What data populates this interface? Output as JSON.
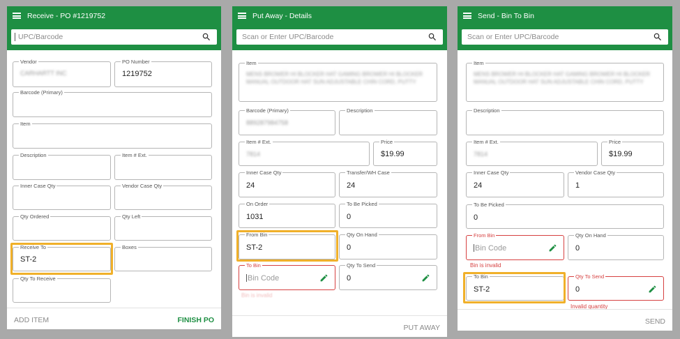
{
  "colors": {
    "brand_green": "#1e8f43",
    "error_red": "#d64040",
    "highlight_orange": "#f0b02a",
    "backdrop": "#a9a9a9"
  },
  "icons": {
    "menu": "hamburger-menu-icon",
    "search": "search-icon",
    "edit": "pencil-icon"
  },
  "receive": {
    "title": "Receive - PO #1219752",
    "search_placeholder": "UPC/Barcode",
    "fields": {
      "vendor": {
        "label": "Vendor",
        "value": "CARHARTT INC"
      },
      "po_number": {
        "label": "PO Number",
        "value": "1219752"
      },
      "barcode": {
        "label": "Barcode (Primary)"
      },
      "item": {
        "label": "Item"
      },
      "description": {
        "label": "Description"
      },
      "item_ext": {
        "label": "Item # Ext."
      },
      "inner_case_qty": {
        "label": "Inner Case Qty"
      },
      "vendor_case_qty": {
        "label": "Vendor Case Qty"
      },
      "qty_ordered": {
        "label": "Qty Ordered"
      },
      "qty_left": {
        "label": "Qty Left"
      },
      "receive_to": {
        "label": "Receive To",
        "value": "ST-2"
      },
      "boxes": {
        "label": "Boxes"
      },
      "qty_to_receive": {
        "label": "Qty To Receive"
      }
    },
    "add_item": "ADD ITEM",
    "finish_po": "FINISH PO"
  },
  "putaway": {
    "title": "Put Away - Details",
    "search_placeholder": "Scan or Enter UPC/Barcode",
    "fields": {
      "item": {
        "label": "Item",
        "value": "MENS BROWER HI BLOCKER HAT GAMING BROWER HI BLOCKER MANUAL OUTDOOR HAT SUN ADJUSTABLE CHIN CORD, PUTTY"
      },
      "barcode": {
        "label": "Barcode (Primary)",
        "value": "889287984758"
      },
      "description": {
        "label": "Description"
      },
      "item_ext": {
        "label": "Item # Ext.",
        "value": "7814"
      },
      "price": {
        "label": "Price",
        "value": "$19.99"
      },
      "inner_case_qty": {
        "label": "Inner Case Qty",
        "value": "24"
      },
      "transfer_case": {
        "label": "Transfer/WH Case",
        "value": "24"
      },
      "on_order": {
        "label": "On Order",
        "value": "1031"
      },
      "to_be_picked": {
        "label": "To Be Picked",
        "value": "0"
      },
      "from_bin": {
        "label": "From Bin",
        "value": "ST-2"
      },
      "qty_on_hand": {
        "label": "Qty On Hand",
        "value": "0"
      },
      "to_bin": {
        "label": "To Bin",
        "placeholder": "Bin Code",
        "error": "Bin is invalid"
      },
      "qty_to_send": {
        "label": "Qty To Send",
        "value": "0"
      }
    },
    "action": "PUT AWAY"
  },
  "send": {
    "title": "Send - Bin To Bin",
    "search_placeholder": "Scan or Enter UPC/Barcode",
    "fields": {
      "item": {
        "label": "Item",
        "value": "MENS BROWER HI BLOCKER HAT GAMING BROWER HI BLOCKER MANUAL OUTDOOR HAT SUN ADJUSTABLE CHIN CORD, PUTTY"
      },
      "description": {
        "label": "Description"
      },
      "item_ext": {
        "label": "Item # Ext.",
        "value": "7814"
      },
      "price": {
        "label": "Price",
        "value": "$19.99"
      },
      "inner_case_qty": {
        "label": "Inner Case Qty",
        "value": "24"
      },
      "vendor_case_qty": {
        "label": "Vendor Case Qty",
        "value": "1"
      },
      "to_be_picked": {
        "label": "To Be Picked",
        "value": "0"
      },
      "from_bin": {
        "label": "From Bin",
        "placeholder": "Bin Code",
        "error": "Bin is invalid"
      },
      "qty_on_hand": {
        "label": "Qty On Hand",
        "value": "0"
      },
      "to_bin": {
        "label": "To Bin",
        "value": "ST-2"
      },
      "qty_to_send": {
        "label": "Qty To Send",
        "value": "0",
        "error": "Invalid quantity"
      }
    },
    "action": "SEND"
  }
}
